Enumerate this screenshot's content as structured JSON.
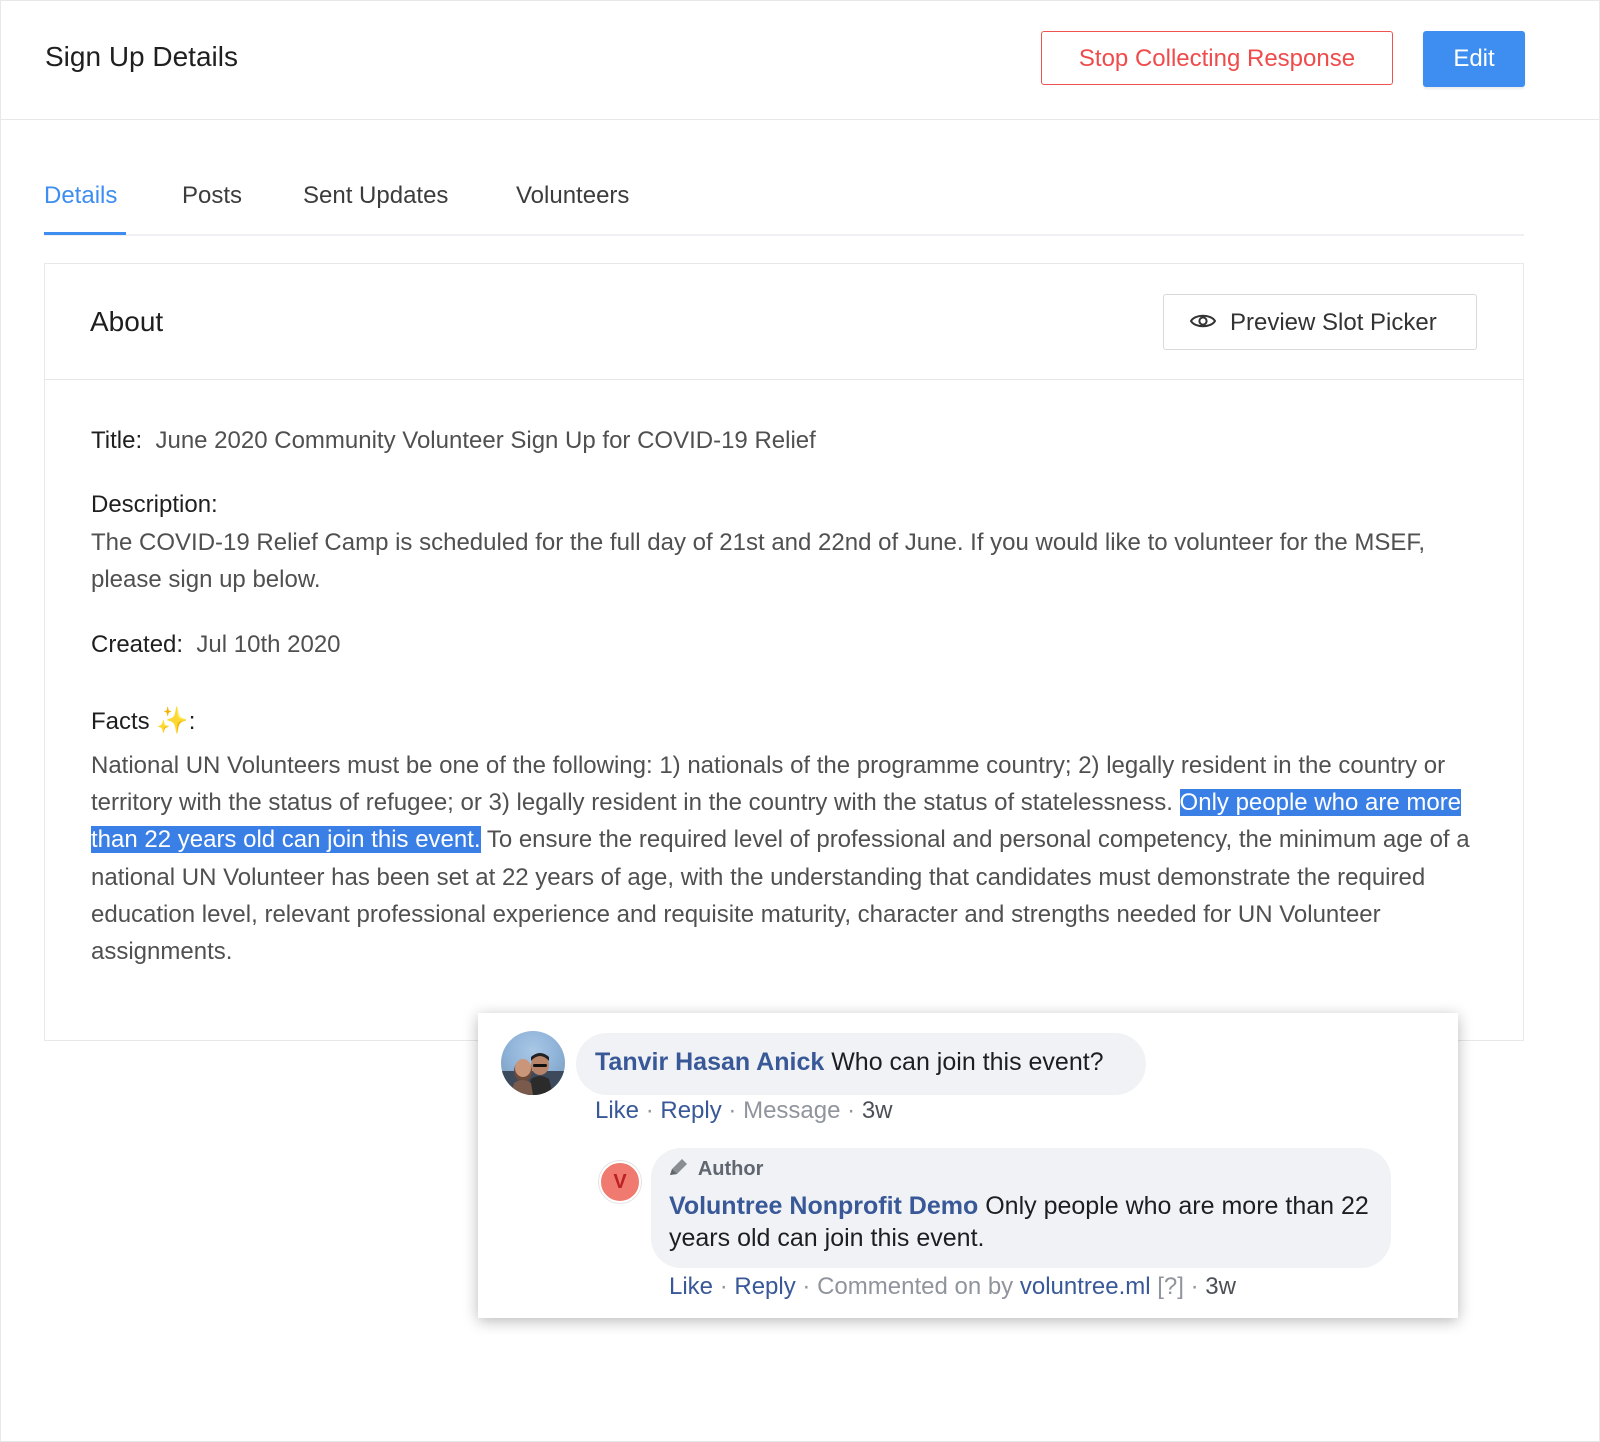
{
  "header": {
    "title": "Sign Up Details",
    "stop_button": "Stop Collecting Response",
    "edit_button": "Edit"
  },
  "tabs": [
    {
      "label": "Details",
      "active": true
    },
    {
      "label": "Posts",
      "active": false
    },
    {
      "label": "Sent Updates",
      "active": false
    },
    {
      "label": "Volunteers",
      "active": false
    }
  ],
  "about": {
    "heading": "About",
    "preview_button": "Preview Slot Picker",
    "title_label": "Title",
    "title_value": "June 2020 Community Volunteer Sign Up for COVID-19 Relief",
    "description_label": "Description",
    "description_value": "The COVID-19 Relief Camp is scheduled for the full day of 21st and 22nd of June. If you would like to volunteer for the MSEF, please sign up below.",
    "created_label": "Created",
    "created_value": "Jul 10th 2020",
    "facts_label": "Facts",
    "facts_emoji": "✨",
    "facts_before": "National UN Volunteers must be one of the following: 1) nationals of the programme country; 2) legally resident in the country or territory with the status of refugee; or 3) legally resident in the country with the status of statelessness.",
    "facts_highlight": "Only people who are more than 22 years old can join this event.",
    "facts_after": "To ensure the required level of professional and personal competency, the minimum age of a national UN Volunteer has been set at 22 years of age, with the understanding that candidates must demonstrate the required education level, relevant professional experience and requisite maturity, character and strengths needed for UN Volunteer assignments."
  },
  "comment": {
    "author": "Tanvir Hasan Anick",
    "text": "Who can join this event?",
    "like": "Like",
    "reply": "Reply",
    "message": "Message",
    "time": "3w"
  },
  "reply": {
    "avatar_letter": "V",
    "author_tag": "Author",
    "author": "Voluntree Nonprofit Demo",
    "text": "Only people who are more than 22 years old can join this event.",
    "like": "Like",
    "reply": "Reply",
    "commented_on": "Commented on by",
    "site": "voluntree.ml",
    "help": "[?]",
    "time": "3w"
  },
  "colors": {
    "accent": "#3d8ef0",
    "danger": "#ef4b4b",
    "highlight": "#3a7fe6",
    "fb_link": "#385898"
  }
}
